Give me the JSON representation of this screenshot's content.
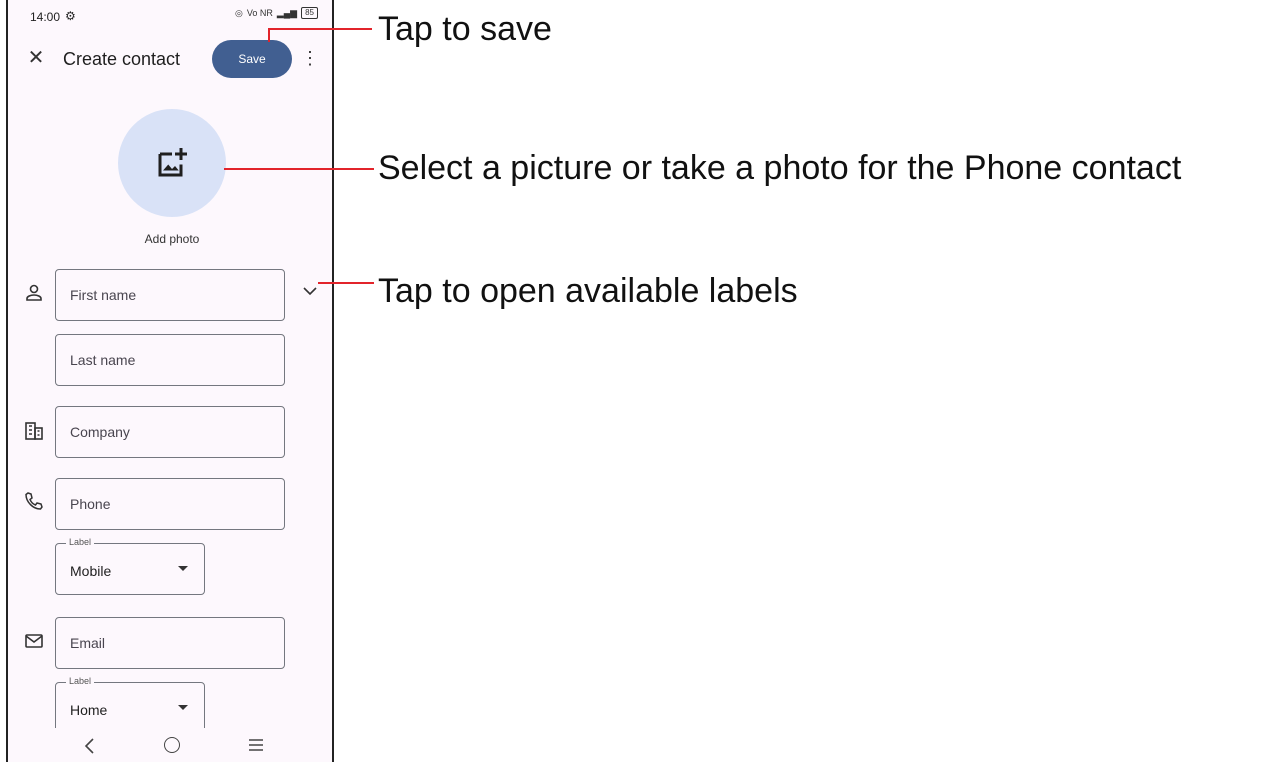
{
  "status_bar": {
    "time": "14:00",
    "network": "Vo NR",
    "battery": "85"
  },
  "toolbar": {
    "title": "Create contact",
    "save_label": "Save"
  },
  "photo": {
    "label": "Add photo"
  },
  "fields": {
    "first_name_placeholder": "First name",
    "last_name_placeholder": "Last name",
    "company_placeholder": "Company",
    "phone_placeholder": "Phone",
    "phone_label_legend": "Label",
    "phone_label_value": "Mobile",
    "email_placeholder": "Email",
    "email_label_legend": "Label",
    "email_label_value": "Home"
  },
  "annotations": {
    "save": "Tap to save",
    "photo": "Select a picture or take a photo for the Phone contact",
    "labels": "Tap to open available labels"
  },
  "colors": {
    "accent": "#415f91",
    "avatar_bg": "#d9e2f7",
    "callout": "#e2242b",
    "screen_bg": "#fdf8fd"
  }
}
